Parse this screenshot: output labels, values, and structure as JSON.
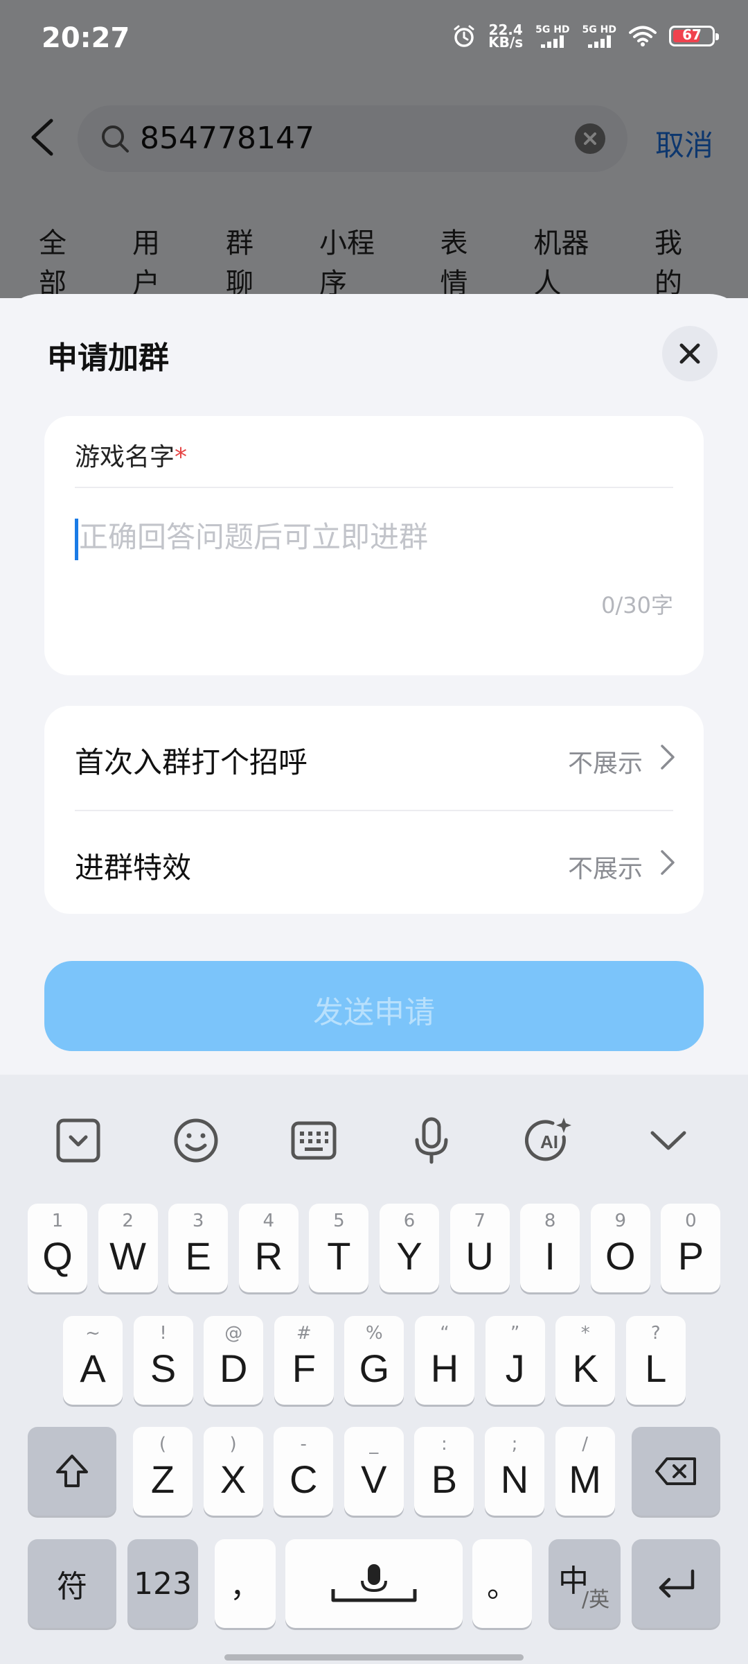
{
  "status_bar": {
    "time": "20:27",
    "net_speed_value": "22.4",
    "net_speed_unit": "KB/s",
    "sim1": "5G HD",
    "sim2": "5G HD",
    "battery": "67"
  },
  "header": {
    "search_value": "854778147",
    "cancel_label": "取消"
  },
  "tabs": [
    "全部",
    "用户",
    "群聊",
    "小程序",
    "表情",
    "机器人",
    "我的"
  ],
  "sheet": {
    "title": "申请加群",
    "question_label": "游戏名字",
    "required_mark": "*",
    "answer_placeholder": "正确回答问题后可立即进群",
    "answer_value": "",
    "char_count": "0/30字",
    "options": [
      {
        "label": "首次入群打个招呼",
        "value": "不展示"
      },
      {
        "label": "进群特效",
        "value": "不展示"
      }
    ],
    "send_label": "发送申请"
  },
  "keyboard": {
    "row1": [
      {
        "main": "Q",
        "sub": "1"
      },
      {
        "main": "W",
        "sub": "2"
      },
      {
        "main": "E",
        "sub": "3"
      },
      {
        "main": "R",
        "sub": "4"
      },
      {
        "main": "T",
        "sub": "5"
      },
      {
        "main": "Y",
        "sub": "6"
      },
      {
        "main": "U",
        "sub": "7"
      },
      {
        "main": "I",
        "sub": "8"
      },
      {
        "main": "O",
        "sub": "9"
      },
      {
        "main": "P",
        "sub": "0"
      }
    ],
    "row2": [
      {
        "main": "A",
        "sub": "~"
      },
      {
        "main": "S",
        "sub": "!"
      },
      {
        "main": "D",
        "sub": "@"
      },
      {
        "main": "F",
        "sub": "#"
      },
      {
        "main": "G",
        "sub": "%"
      },
      {
        "main": "H",
        "sub": "“"
      },
      {
        "main": "J",
        "sub": "”"
      },
      {
        "main": "K",
        "sub": "*"
      },
      {
        "main": "L",
        "sub": "?"
      }
    ],
    "row3": [
      {
        "main": "Z",
        "sub": "("
      },
      {
        "main": "X",
        "sub": ")"
      },
      {
        "main": "C",
        "sub": "-"
      },
      {
        "main": "V",
        "sub": "_"
      },
      {
        "main": "B",
        "sub": ":"
      },
      {
        "main": "N",
        "sub": ";"
      },
      {
        "main": "M",
        "sub": "/"
      }
    ],
    "symbol_key": "符",
    "number_key": "123",
    "comma_key": "，",
    "period_key": "。",
    "lang_main": "中",
    "lang_sub": "/英",
    "toolbar_icons": [
      "clipboard-icon",
      "emoji-icon",
      "keyboard-layout-icon",
      "microphone-icon",
      "ai-assistant-icon",
      "collapse-keyboard-icon"
    ]
  },
  "colors": {
    "accent": "#1a7be6",
    "send_disabled": "#7bc4fa",
    "required": "#e64545",
    "battery": "#f0424e"
  }
}
